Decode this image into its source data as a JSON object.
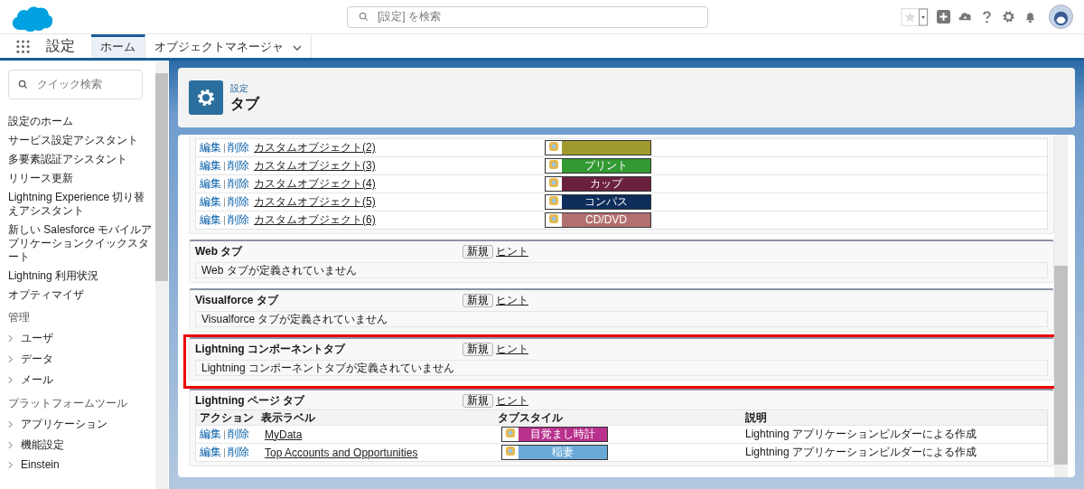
{
  "header": {
    "search": {
      "placeholder": "[設定] を検索"
    }
  },
  "nav": {
    "app_title": "設定",
    "tabs": [
      {
        "label": "ホーム",
        "selected": true,
        "has_menu": false
      },
      {
        "label": "オブジェクトマネージャ",
        "selected": false,
        "has_menu": true
      }
    ]
  },
  "sidebar": {
    "search": {
      "placeholder": "クイック検索"
    },
    "items": [
      {
        "kind": "link",
        "label": "設定のホーム"
      },
      {
        "kind": "link",
        "label": "サービス設定アシスタント"
      },
      {
        "kind": "link",
        "label": "多要素認証アシスタント"
      },
      {
        "kind": "link",
        "label": "リリース更新"
      },
      {
        "kind": "link",
        "label": "Lightning Experience 切り替えアシスタント"
      },
      {
        "kind": "link",
        "label": "新しい Salesforce モバイルアプリケーションクイックスタート"
      },
      {
        "kind": "link",
        "label": "Lightning 利用状況"
      },
      {
        "kind": "link",
        "label": "オプティマイザ"
      },
      {
        "kind": "heading",
        "label": "管理"
      },
      {
        "kind": "group",
        "label": "ユーザ",
        "expanded": false
      },
      {
        "kind": "group",
        "label": "データ",
        "expanded": false
      },
      {
        "kind": "group",
        "label": "メール",
        "expanded": false
      },
      {
        "kind": "heading",
        "label": "プラットフォームツール"
      },
      {
        "kind": "group",
        "label": "アプリケーション",
        "expanded": false
      },
      {
        "kind": "group",
        "label": "機能設定",
        "expanded": false
      },
      {
        "kind": "group",
        "label": "Einstein",
        "expanded": false
      }
    ]
  },
  "page_header": {
    "breadcrumb": "設定",
    "title": "タブ"
  },
  "custom_object_rows": [
    {
      "edit": "編集",
      "delete": "削除",
      "label": "カスタムオブジェクト(2)",
      "style": {
        "color": "#a09a2e"
      }
    },
    {
      "edit": "編集",
      "delete": "削除",
      "label": "カスタムオブジェクト(3)",
      "style": {
        "name": "プリント",
        "color": "#339933"
      }
    },
    {
      "edit": "編集",
      "delete": "削除",
      "label": "カスタムオブジェクト(4)",
      "style": {
        "name": "カップ",
        "color": "#6b213d"
      }
    },
    {
      "edit": "編集",
      "delete": "削除",
      "label": "カスタムオブジェクト(5)",
      "style": {
        "name": "コンパス",
        "color": "#0e2d5a"
      }
    },
    {
      "edit": "編集",
      "delete": "削除",
      "label": "カスタムオブジェクト(6)",
      "style": {
        "name": "CD/DVD",
        "color": "#b37070"
      }
    }
  ],
  "sections": [
    {
      "title": "Web タブ",
      "new_button": "新規",
      "hint": "ヒント",
      "highlighted": false,
      "empty_message": "Web タブが定義されていません"
    },
    {
      "title": "Visualforce タブ",
      "new_button": "新規",
      "hint": "ヒント",
      "highlighted": false,
      "empty_message": "Visualforce タブが定義されていません"
    },
    {
      "title": "Lightning コンポーネントタブ",
      "new_button": "新規",
      "hint": "ヒント",
      "highlighted": true,
      "empty_message": "Lightning コンポーネントタブが定義されていません"
    },
    {
      "title": "Lightning ページ タブ",
      "new_button": "新規",
      "hint": "ヒント",
      "highlighted": false,
      "table": {
        "columns": [
          "アクション",
          "表示ラベル",
          "タブスタイル",
          "説明"
        ],
        "rows": [
          {
            "edit": "編集",
            "delete": "削除",
            "label": "MyData",
            "style": {
              "name": "目覚まし時計",
              "color": "#b8318c"
            },
            "description": "Lightning アプリケーションビルダーによる作成"
          },
          {
            "edit": "編集",
            "delete": "削除",
            "label": "Top Accounts and Opportunities",
            "style": {
              "name": "稲妻",
              "color": "#6aa8d8"
            },
            "description": "Lightning アプリケーションビルダーによる作成"
          }
        ]
      }
    }
  ]
}
